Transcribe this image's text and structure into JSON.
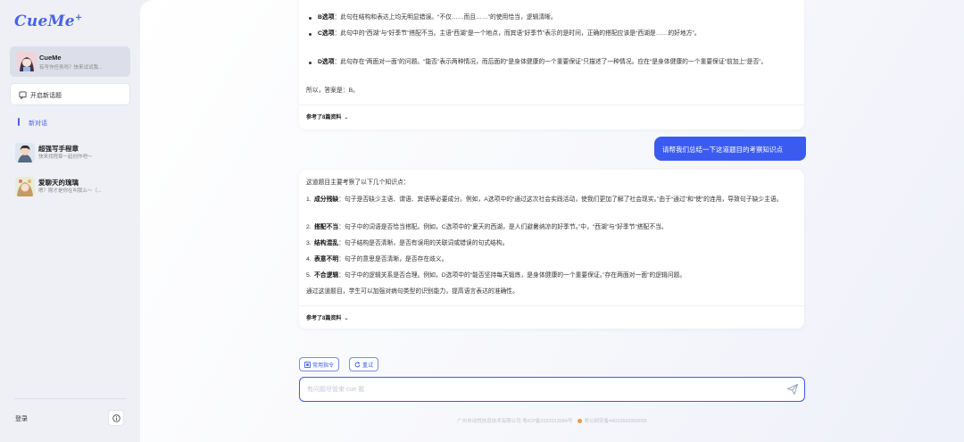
{
  "sidebar": {
    "logo_text": "CueMe",
    "logo_mark": "+",
    "current_bot": {
      "name": "CueMe",
      "desc": "有写作任务吗？快来试试我..."
    },
    "new_topic_label": "开启新话题",
    "new_chat_label": "新对话",
    "bots": [
      {
        "name": "超强写手程章",
        "desc": "快来找程章一起创作吧～"
      },
      {
        "name": "爱聊天的瑰璃",
        "desc": "嗯？刚才是你在叫我么～（..."
      }
    ],
    "login_label": "登录"
  },
  "chat": {
    "answer1": {
      "b_label": "B选项",
      "b_text": "：此句在结构和表达上均无明显错误。“不仅……而且……”的使用恰当，逻辑清晰。",
      "c_label": "C选项",
      "c_text": "：此句中的“西湖”与“好季节”搭配不当。主语“西湖”是一个地点，而宾语“好季节”表示的是时间，正确的搭配应该是“西湖是……的好地方”。",
      "d_label": "D选项",
      "d_text": "：此句存在“两面对一面”的问题。“能否”表示两种情况，而后面的“是身体健康的一个重要保证”只描述了一种情况。应在“是身体健康的一个重要保证”前加上“是否”。",
      "conclusion": "所以，答案是：B。",
      "ref_label": "参考了8篇资料"
    },
    "user_message": "请帮我们总结一下这道题目的考察知识点",
    "answer2": {
      "intro": "这道题目主要考察了以下几个知识点：",
      "items": [
        {
          "num": "1.",
          "label": "成分残缺",
          "text": "：句子是否缺少主语、谓语、宾语等必要成分。例如，A选项中的“通过这次社会实践活动，使我们更加了解了社会现实。”由于“通过”和“使”的连用，导致句子缺少主语。"
        },
        {
          "num": "2.",
          "label": "搭配不当",
          "text": "：句子中的词语是否恰当搭配。例如，C选项中的“夏天的西湖，是人们避暑纳凉的好季节。”中，“西湖”与“好季节”搭配不当。"
        },
        {
          "num": "3.",
          "label": "结构混乱",
          "text": "：句子结构是否清晰，是否有误用的关联词或错误的句式结构。"
        },
        {
          "num": "4.",
          "label": "表意不明",
          "text": "：句子的意思是否清晰，是否存在歧义。"
        },
        {
          "num": "5.",
          "label": "不合逻辑",
          "text": "：句子中的逻辑关系是否合理。例如，D选项中的“能否坚持每天锻炼，是身体健康的一个重要保证。”存在两面对一面”的逻辑问题。"
        }
      ],
      "summary": "通过这道题目，学生可以加强对病句类型的识别能力，提高语言表达的准确性。",
      "ref_label": "参考了8篇资料"
    }
  },
  "composer": {
    "common_cmd_label": "常用指令",
    "retry_label": "重试",
    "placeholder": "有问题尽管来 cue 我"
  },
  "footer": {
    "company": "广州市动悦信息技术有限公司 粤ICP备2022013984号",
    "police": "粤公网安备44010502000055"
  },
  "colors": {
    "accent": "#3b5bf0",
    "logo": "#4a62e8"
  }
}
